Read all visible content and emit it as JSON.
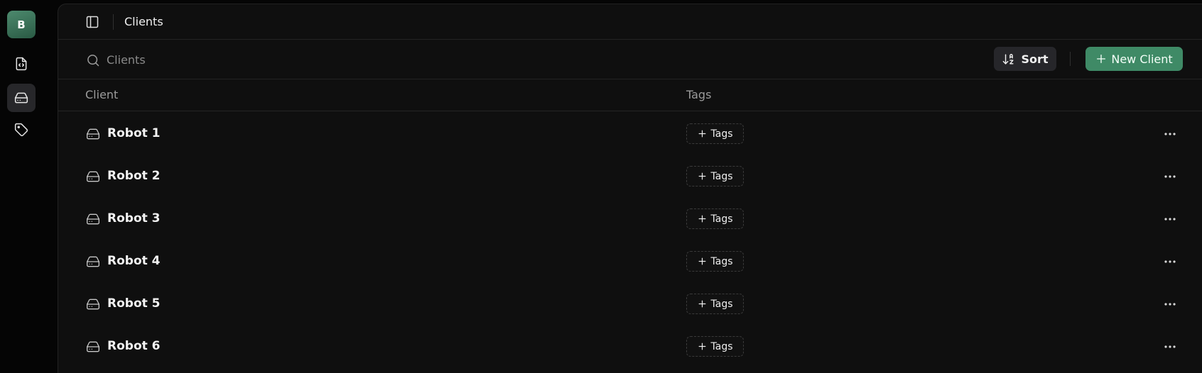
{
  "rail": {
    "avatar_letter": "B",
    "items": [
      {
        "icon": "file-code-icon",
        "active": false
      },
      {
        "icon": "hard-drive-icon",
        "active": true
      },
      {
        "icon": "tag-icon",
        "active": false
      }
    ]
  },
  "topbar": {
    "breadcrumb": "Clients"
  },
  "toolbar": {
    "search_placeholder": "Clients",
    "sort_label": "Sort",
    "new_label": "New Client"
  },
  "table": {
    "columns": [
      "Client",
      "Tags"
    ],
    "rows": [
      {
        "name": "Robot 1",
        "tag_label": "Tags"
      },
      {
        "name": "Robot 2",
        "tag_label": "Tags"
      },
      {
        "name": "Robot 3",
        "tag_label": "Tags"
      },
      {
        "name": "Robot 4",
        "tag_label": "Tags"
      },
      {
        "name": "Robot 5",
        "tag_label": "Tags"
      },
      {
        "name": "Robot 6",
        "tag_label": "Tags"
      }
    ]
  },
  "colors": {
    "accent": "#3f8a66",
    "background": "#0f0f0f"
  }
}
